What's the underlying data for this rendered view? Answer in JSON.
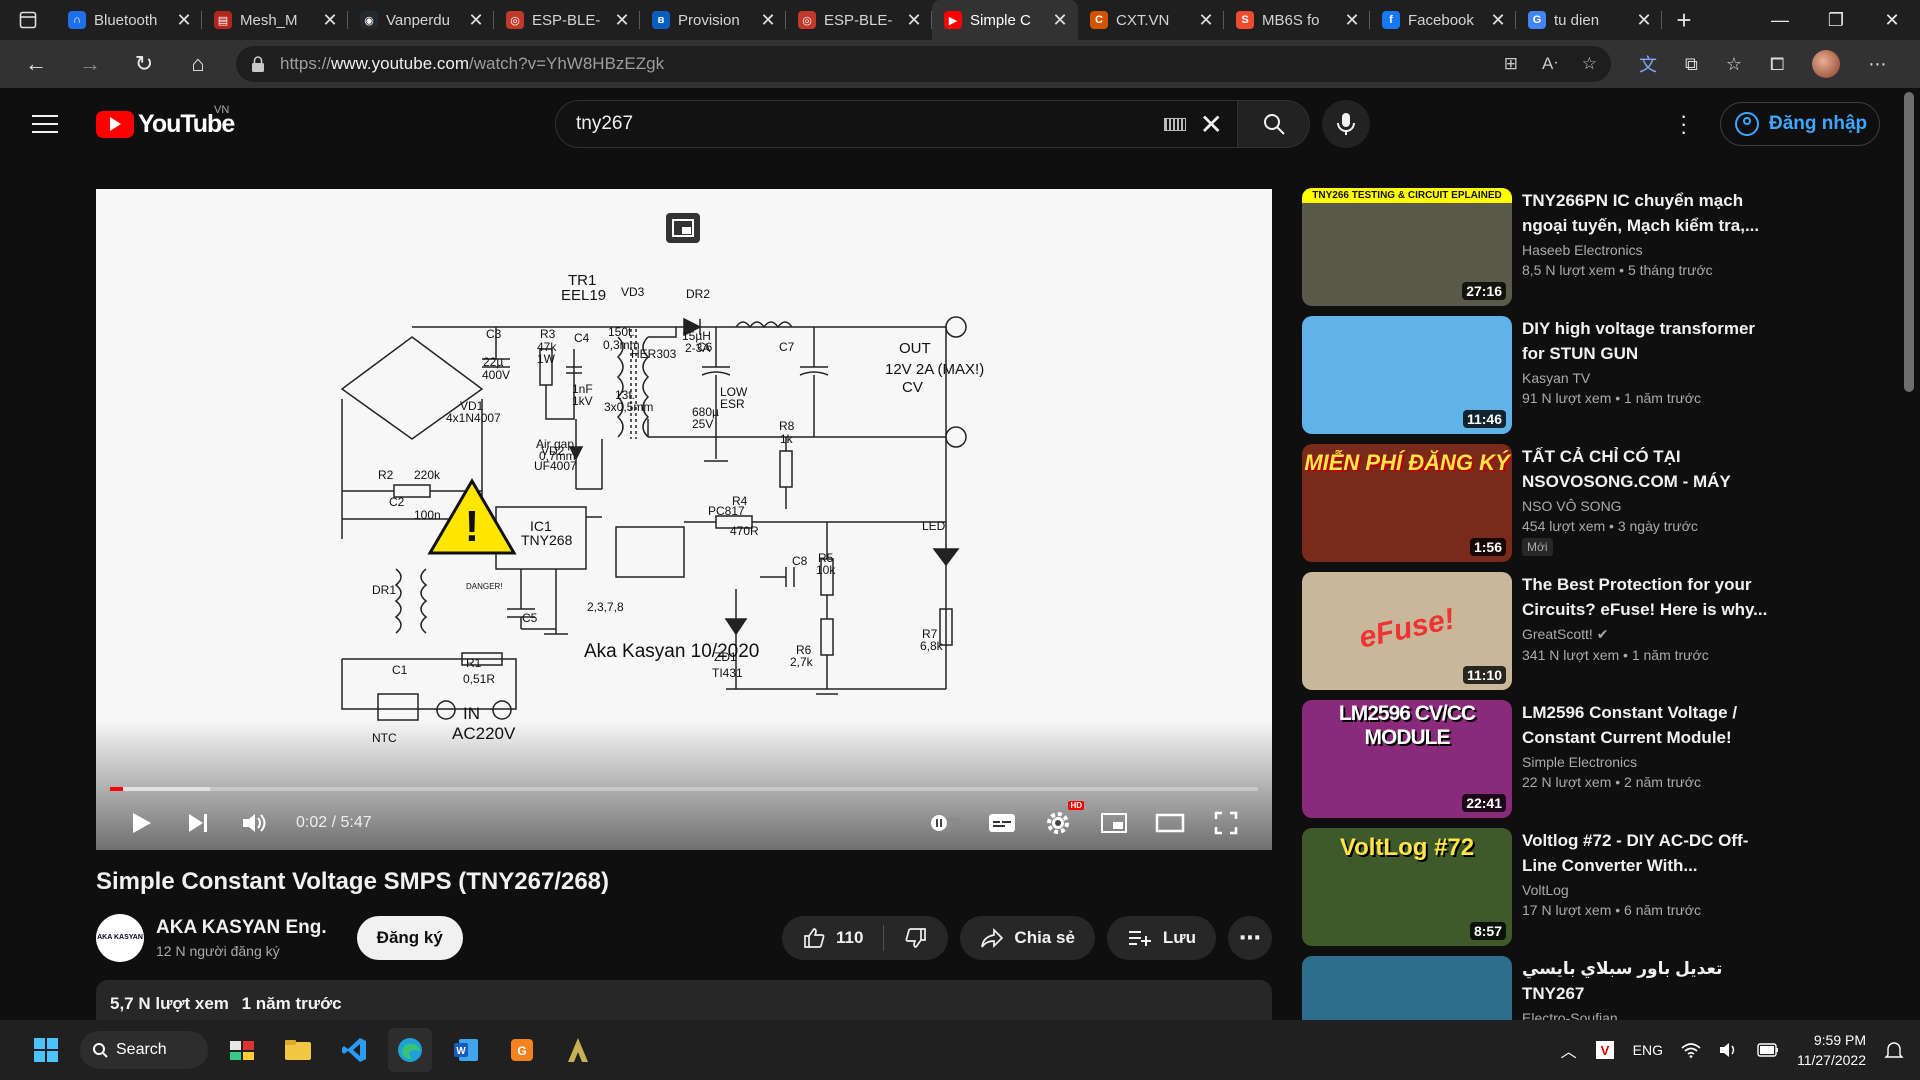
{
  "browser": {
    "tabs": [
      {
        "title": "Bluetooth",
        "favicon": "bluetooth-site-icon",
        "color": "#1f6feb",
        "glyph": "∩",
        "active": false
      },
      {
        "title": "Mesh_M",
        "favicon": "pdf-icon",
        "color": "#b3261e",
        "glyph": "▤",
        "active": false
      },
      {
        "title": "Vanperdu",
        "favicon": "github-icon",
        "color": "#24292f",
        "glyph": "◉",
        "active": false
      },
      {
        "title": "ESP-BLE-",
        "favicon": "espressif-icon",
        "color": "#c0392b",
        "glyph": "◎",
        "active": false
      },
      {
        "title": "Provision",
        "favicon": "bluetooth-icon",
        "color": "#0a5ec0",
        "glyph": "ʙ",
        "active": false
      },
      {
        "title": "ESP-BLE-",
        "favicon": "espressif-icon",
        "color": "#c0392b",
        "glyph": "◎",
        "active": false
      },
      {
        "title": "Simple C",
        "favicon": "youtube-icon",
        "color": "#ff0000",
        "glyph": "▶",
        "active": true
      },
      {
        "title": "CXT.VN",
        "favicon": "cxt-icon",
        "color": "#d35400",
        "glyph": "C",
        "active": false
      },
      {
        "title": "MB6S fo",
        "favicon": "shop-icon",
        "color": "#ee4d2d",
        "glyph": "S",
        "active": false
      },
      {
        "title": "Facebook",
        "favicon": "facebook-icon",
        "color": "#1877f2",
        "glyph": "f",
        "active": false
      },
      {
        "title": "tu dien",
        "favicon": "google-icon",
        "color": "#4285f4",
        "glyph": "G",
        "active": false
      }
    ],
    "url_prefix": "https://",
    "url_domain": "www.youtube.com",
    "url_path": "/watch?v=YhW8HBzEZgk"
  },
  "youtube": {
    "country_code": "VN",
    "logo_text": "YouTube",
    "search_query": "tny267",
    "sign_in_label": "Đăng nhập"
  },
  "player": {
    "time": "0:02 / 5:47",
    "progress_fraction": 0.006,
    "hd_badge": "HD"
  },
  "schematic": {
    "labels": [
      "TR1",
      "EEL19",
      "VD3",
      "DR2",
      "C3",
      "R3",
      "C4",
      "150t.",
      "0,3mm",
      "HER303",
      "15µH",
      "2-3A",
      "C6",
      "C7",
      "22µ",
      "400V",
      "47k",
      "1W",
      "1nF",
      "1kV",
      "13t.",
      "3x0,5mm",
      "680µ",
      "25V",
      "LOW",
      "ESR",
      "OUT",
      "12V 2A (MAX!)",
      "CV",
      "VD1",
      "4x1N4007",
      "VD2",
      "UF4007",
      "Air gap",
      "0,7mm",
      "R8",
      "1k",
      "R2",
      "220k",
      "C2",
      "100n",
      "IC1",
      "TNY268",
      "PC817",
      "R4",
      "470R",
      "C8",
      "LED",
      "R5",
      "10k",
      "DR1",
      "C5",
      "2,3,7,8",
      "ZD1",
      "TI431",
      "R6",
      "2,7k",
      "R7",
      "6,8k",
      "DANGER!",
      "C1",
      "R1",
      "0,51R",
      "NTC",
      "IN",
      "AC220V",
      "Aka Kasyan 10/2020"
    ]
  },
  "video": {
    "title": "Simple Constant Voltage SMPS (TNY267/268)",
    "channel": "AKA KASYAN Eng.",
    "channel_avatar_text": "AKA KASYAN",
    "subscribers": "12 N người đăng ký",
    "subscribe_label": "Đăng ký",
    "likes": "110",
    "share_label": "Chia sẻ",
    "save_label": "Lưu",
    "views": "5,7 N lượt xem",
    "published": "1 năm trước"
  },
  "recommendations": [
    {
      "title": "TNY266PN IC chuyển mạch ngoại tuyến, Mạch kiểm tra,...",
      "channel": "Haseeb Electronics",
      "views": "8,5 N lượt xem",
      "age": "5 tháng trước",
      "duration": "27:16",
      "thumb_text": "TNY266 TESTING & CIRCUIT EPLAINED",
      "thumb_bg": "#5a5a4a",
      "verified": false,
      "badge": ""
    },
    {
      "title": "DIY high voltage transformer for STUN GUN",
      "channel": "Kasyan TV",
      "views": "91 N lượt xem",
      "age": "1 năm trước",
      "duration": "11:46",
      "thumb_text": "",
      "thumb_bg": "#5fb3e8",
      "verified": false,
      "badge": ""
    },
    {
      "title": "TẤT CẢ CHỈ CÓ TẠI NSOVOSONG.COM - MÁY CHỦ...",
      "channel": "NSO VÔ SONG",
      "views": "454 lượt xem",
      "age": "3 ngày trước",
      "duration": "1:56",
      "thumb_text": "MIỄN PHÍ ĐĂNG KÝ",
      "thumb_bg": "#7a2a1a",
      "verified": false,
      "badge": "Mới"
    },
    {
      "title": "The Best Protection for your Circuits? eFuse! Here is why...",
      "channel": "GreatScott!",
      "views": "341 N lượt xem",
      "age": "1 năm trước",
      "duration": "11:10",
      "thumb_text": "eFuse!",
      "thumb_bg": "#c9b79a",
      "verified": true,
      "badge": ""
    },
    {
      "title": "LM2596 Constant Voltage / Constant Current Module!",
      "channel": "Simple Electronics",
      "views": "22 N lượt xem",
      "age": "2 năm trước",
      "duration": "22:41",
      "thumb_text": "LM2596 CV/CC MODULE",
      "thumb_bg": "#8a2a7a",
      "verified": false,
      "badge": ""
    },
    {
      "title": "Voltlog #72 - DIY AC-DC Off-Line Converter With...",
      "channel": "VoltLog",
      "views": "17 N lượt xem",
      "age": "6 năm trước",
      "duration": "8:57",
      "thumb_text": "VoltLog #72",
      "thumb_bg": "#3f5a2a",
      "verified": false,
      "badge": ""
    },
    {
      "title": "تعديل باور سبلاي بايسي TNY267",
      "channel": "Electro-Soufian",
      "views": "",
      "age": "",
      "duration": "",
      "thumb_text": "",
      "thumb_bg": "#2d6e8e",
      "verified": false,
      "badge": ""
    }
  ],
  "taskbar": {
    "search_label": "Search",
    "lang": "ENG",
    "time": "9:59 PM",
    "date": "11/27/2022"
  }
}
